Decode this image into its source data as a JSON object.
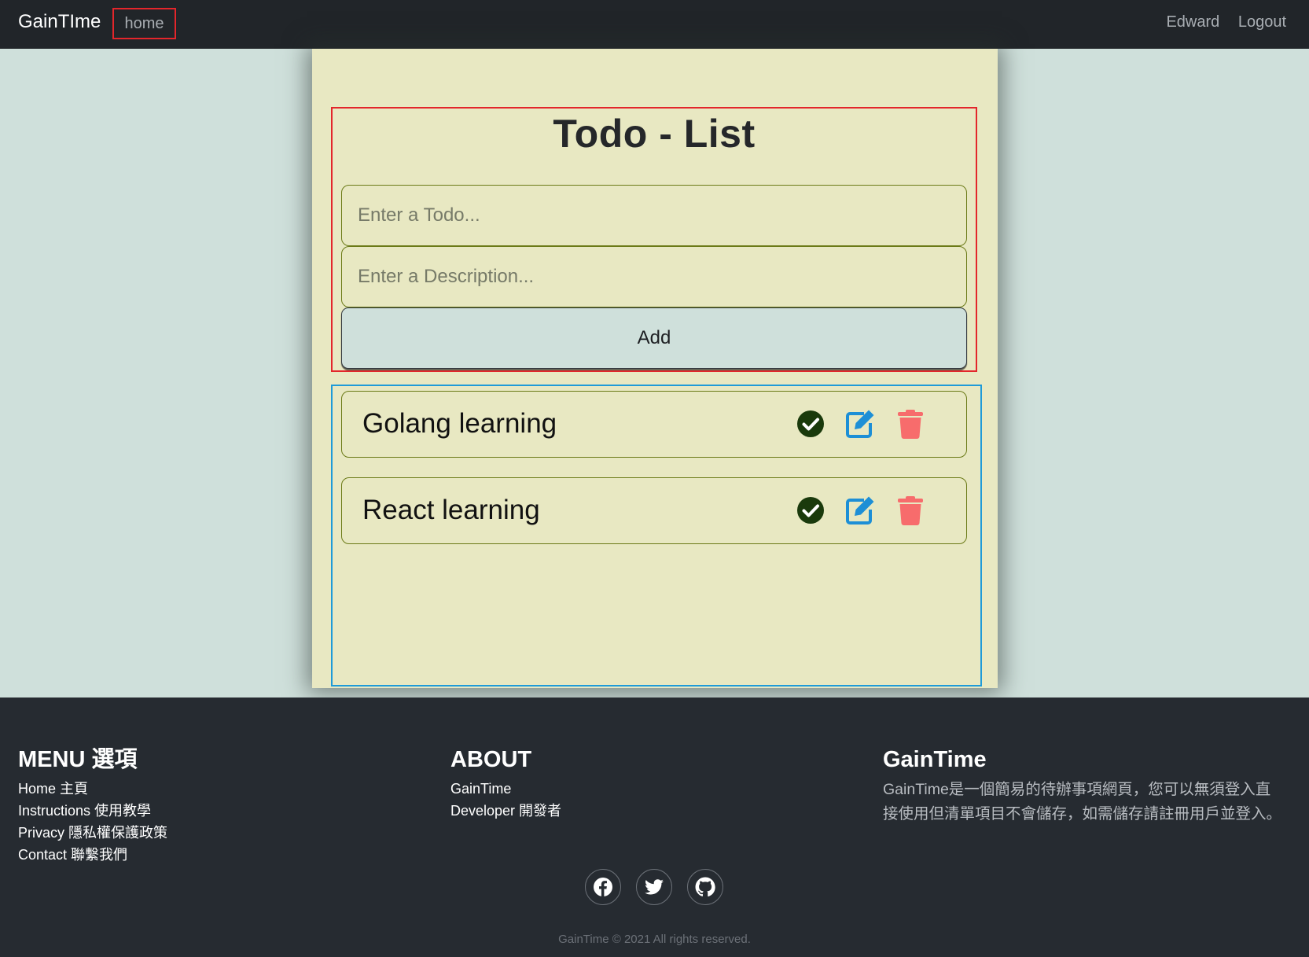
{
  "navbar": {
    "brand": "GainTIme",
    "home_label": "home",
    "user_name": "Edward",
    "logout_label": "Logout"
  },
  "todo_form": {
    "title": "Todo - List",
    "todo_placeholder": "Enter a Todo...",
    "description_placeholder": "Enter a Description...",
    "add_label": "Add"
  },
  "todos": [
    {
      "text": "Golang learning"
    },
    {
      "text": "React learning"
    }
  ],
  "actions": {
    "complete_icon": "check-circle-icon",
    "edit_icon": "edit-icon",
    "delete_icon": "trash-icon"
  },
  "footer": {
    "menu": {
      "title": "MENU 選項",
      "links": [
        "Home 主頁",
        "Instructions 使用教學",
        "Privacy 隱私權保護政策",
        "Contact 聯繫我們"
      ]
    },
    "about": {
      "title": "ABOUT",
      "links": [
        "GainTime",
        "Developer 開發者"
      ]
    },
    "gaintime": {
      "title": "GainTime",
      "description_line1": "GainTime是一個簡易的待辦事項網頁，您可以無須登入直",
      "description_line2": "接使用但清單項目不會儲存，如需儲存請註冊用戶並登入。"
    },
    "socials": [
      "facebook-icon",
      "twitter-icon",
      "github-icon"
    ],
    "copyright": "GainTime © 2021 All rights reserved."
  },
  "colors": {
    "navbar_bg": "#212529",
    "page_bg": "#cfe0db",
    "card_bg": "#e8e8c2",
    "highlight_red": "#e3262b",
    "highlight_blue": "#1f9bd8",
    "check_green": "#1a3a0c",
    "edit_blue": "#1d8fd6",
    "delete_red": "#f76c6c",
    "footer_bg": "#262b31"
  }
}
